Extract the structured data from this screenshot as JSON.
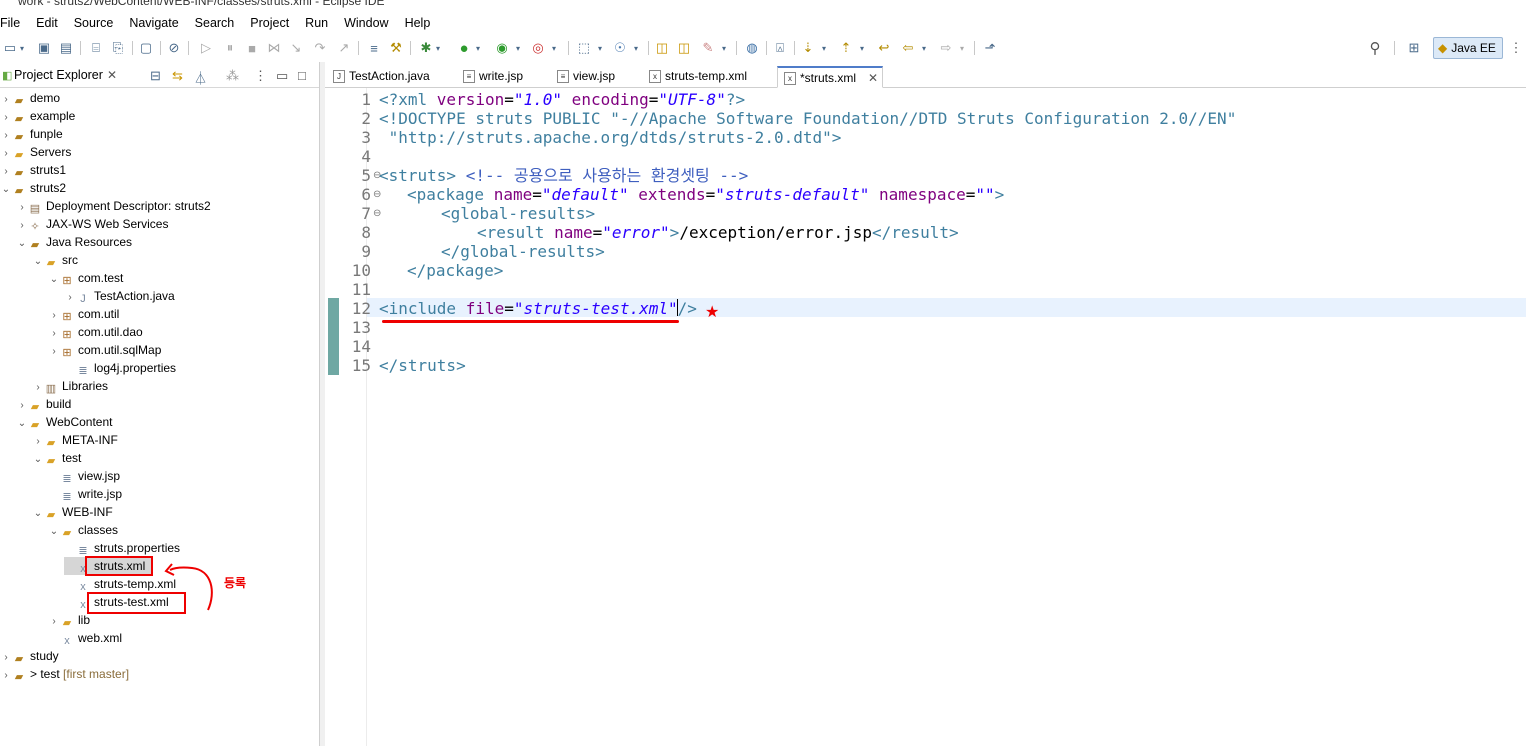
{
  "window": {
    "title": "work - struts2/WebContent/WEB-INF/classes/struts.xml - Eclipse IDE"
  },
  "menu": [
    "File",
    "Edit",
    "Source",
    "Navigate",
    "Search",
    "Project",
    "Run",
    "Window",
    "Help"
  ],
  "perspective": {
    "label": "Java EE"
  },
  "explorer": {
    "title": "Project Explorer",
    "tree": [
      {
        "label": "demo"
      },
      {
        "label": "example"
      },
      {
        "label": "funple"
      },
      {
        "label": "Servers"
      },
      {
        "label": "struts1"
      },
      {
        "label": "struts2"
      },
      {
        "label": "Deployment Descriptor: struts2"
      },
      {
        "label": "JAX-WS Web Services"
      },
      {
        "label": "Java Resources"
      },
      {
        "label": "src"
      },
      {
        "label": "com.test"
      },
      {
        "label": "TestAction.java"
      },
      {
        "label": "com.util"
      },
      {
        "label": "com.util.dao"
      },
      {
        "label": "com.util.sqlMap"
      },
      {
        "label": "log4j.properties"
      },
      {
        "label": "Libraries"
      },
      {
        "label": "build"
      },
      {
        "label": "WebContent"
      },
      {
        "label": "META-INF"
      },
      {
        "label": "test"
      },
      {
        "label": "view.jsp"
      },
      {
        "label": "write.jsp"
      },
      {
        "label": "WEB-INF"
      },
      {
        "label": "classes"
      },
      {
        "label": "struts.properties"
      },
      {
        "label": "struts.xml"
      },
      {
        "label": "struts-temp.xml"
      },
      {
        "label": "struts-test.xml"
      },
      {
        "label": "lib"
      },
      {
        "label": "web.xml"
      },
      {
        "label": "study"
      },
      {
        "label": "> test",
        "suffix": "[first master]"
      }
    ]
  },
  "annotation": {
    "label": "등록"
  },
  "editor": {
    "tabs": [
      {
        "label": "TestAction.java"
      },
      {
        "label": "write.jsp"
      },
      {
        "label": "view.jsp"
      },
      {
        "label": "struts-temp.xml"
      },
      {
        "label": "*struts.xml"
      }
    ],
    "line_numbers": [
      "1",
      "2",
      "3",
      "4",
      "5",
      "6",
      "7",
      "8",
      "9",
      "10",
      "11",
      "12",
      "13",
      "14",
      "15"
    ],
    "lines": {
      "l1a": "<?xml ",
      "l1b": "version",
      "l1c": "=",
      "l1d": "\"1.0\"",
      "l1e": " encoding",
      "l1f": "=",
      "l1g": "\"UTF-8\"",
      "l1h": "?>",
      "l2": "<!DOCTYPE struts PUBLIC \"-//Apache Software Foundation//DTD Struts Configuration 2.0//EN\"",
      "l3": " \"http://struts.apache.org/dtds/struts-2.0.dtd\">",
      "l5a": "<struts>",
      "l5b": " <!-- 공용으로 사용하는 환경셋팅 -->",
      "l6a": "<package ",
      "l6b": "name",
      "l6c": "=",
      "l6d": "\"default\"",
      "l6e": " extends",
      "l6f": "=",
      "l6g": "\"struts-default\"",
      "l6h": " namespace",
      "l6i": "=",
      "l6j": "\"\"",
      "l6k": ">",
      "l7": "<global-results>",
      "l8a": "<result ",
      "l8b": "name",
      "l8c": "=",
      "l8d": "\"error\"",
      "l8e": ">",
      "l8f": "/exception/error.jsp",
      "l8g": "</result>",
      "l9": "</global-results>",
      "l10": "</package>",
      "l12a": "<include ",
      "l12b": "file",
      "l12c": "=",
      "l12d": "\"struts-test.xml\"",
      "l12e": "/>",
      "l15": "</struts>"
    }
  }
}
